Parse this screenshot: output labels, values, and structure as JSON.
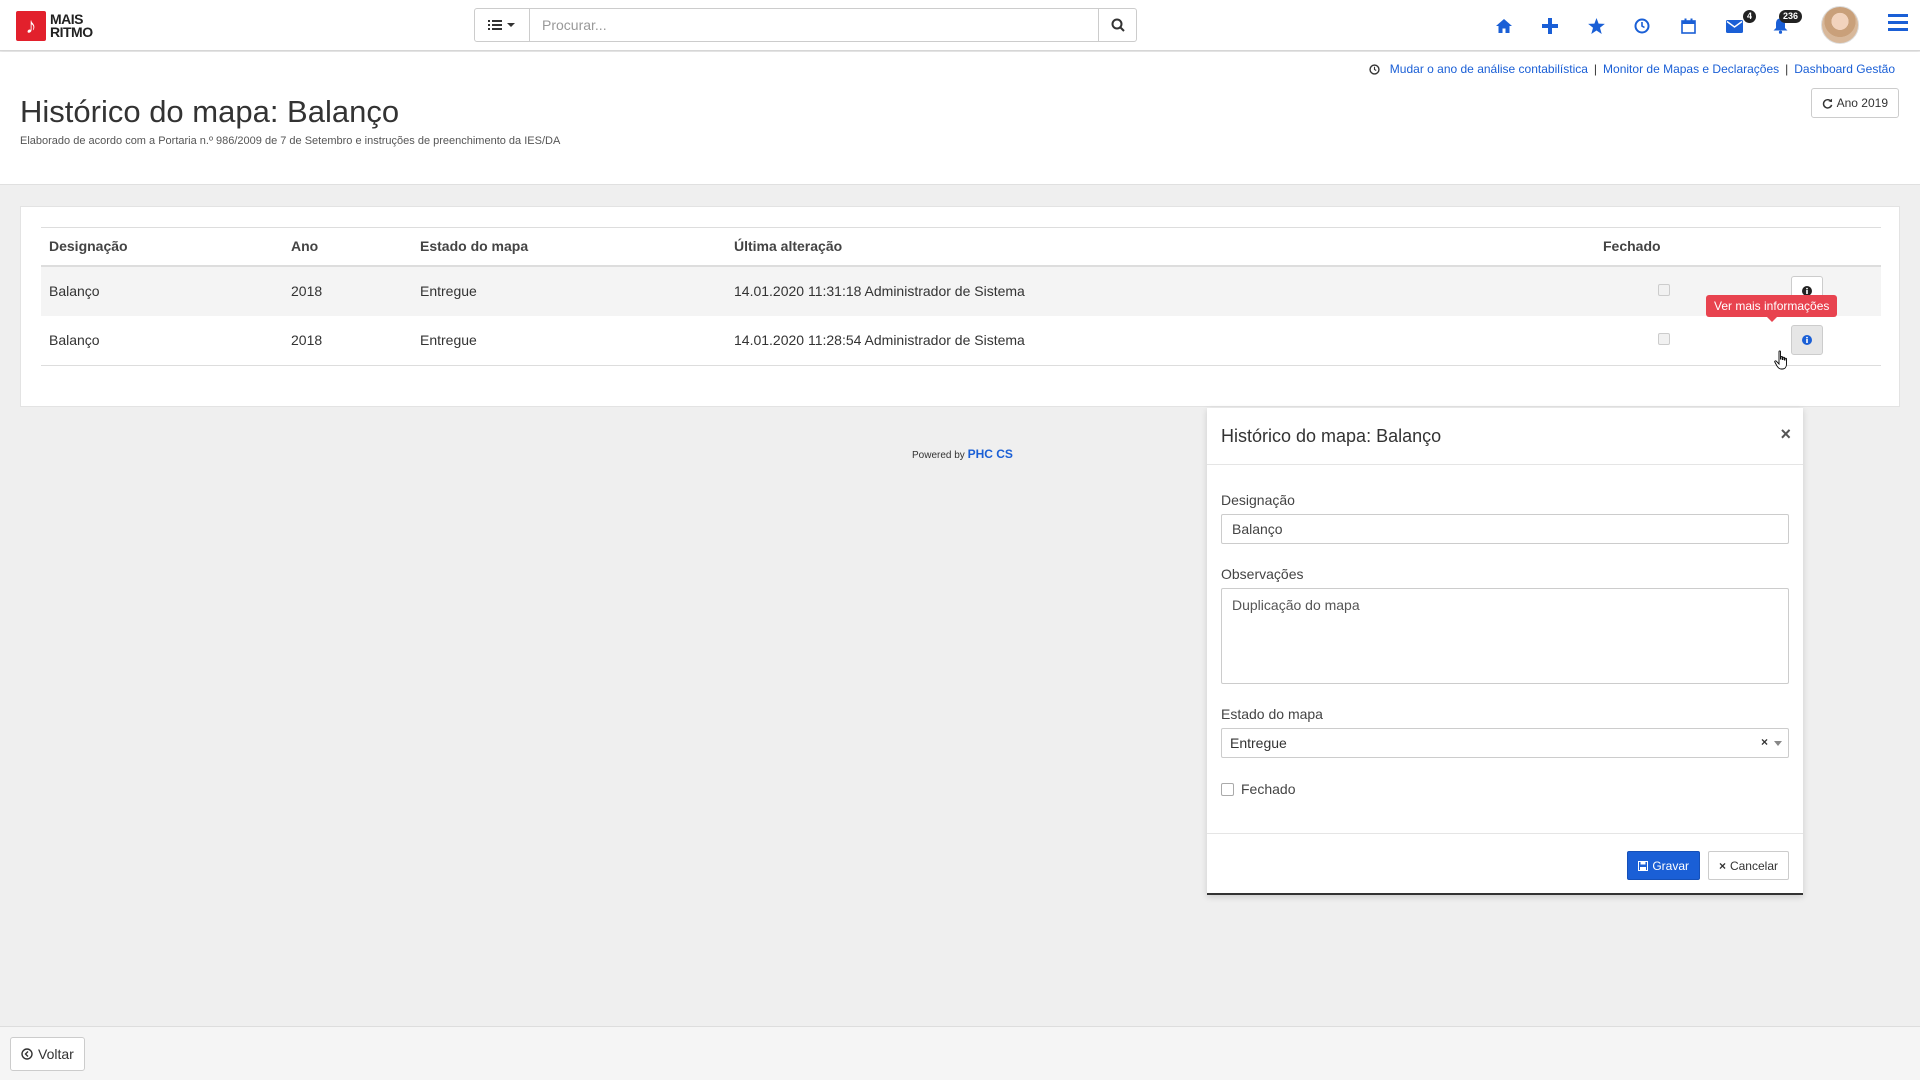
{
  "brand": {
    "line1": "MAIS",
    "line2": "RITMO",
    "color": "#e2202c"
  },
  "search": {
    "placeholder": "Procurar..."
  },
  "nav": {
    "icons": [
      "home-icon",
      "plus-icon",
      "star-icon",
      "clock-icon",
      "calendar-icon",
      "envelope-icon",
      "bell-icon"
    ],
    "mail_badge": "4",
    "notif_badge": "236",
    "accent": "#1a5fd6"
  },
  "header": {
    "links": [
      "Mudar o ano de análise contabilística",
      "Monitor de Mapas e Declarações",
      "Dashboard Gestão"
    ],
    "year_button": "Ano 2019",
    "title": "Histórico do mapa: Balanço",
    "subtitle": "Elaborado de acordo com a Portaria n.º 986/2009 de 7 de Setembro e instruções de preenchimento da IES/DA"
  },
  "table": {
    "columns": [
      "Designação",
      "Ano",
      "Estado do mapa",
      "Última alteração",
      "Fechado"
    ],
    "rows": [
      {
        "designacao": "Balanço",
        "ano": "2018",
        "estado": "Entregue",
        "alteracao": "14.01.2020 11:31:18 Administrador de Sistema",
        "fechado": false
      },
      {
        "designacao": "Balanço",
        "ano": "2018",
        "estado": "Entregue",
        "alteracao": "14.01.2020 11:28:54 Administrador de Sistema",
        "fechado": false
      }
    ],
    "tooltip": "Ver mais informações"
  },
  "footer": {
    "powered_by": "Powered by",
    "product": "PHC CS"
  },
  "modal": {
    "title": "Histórico do mapa: Balanço",
    "designacao_label": "Designação",
    "designacao_value": "Balanço",
    "observacoes_label": "Observações",
    "observacoes_value": "Duplicação do mapa",
    "estado_label": "Estado do mapa",
    "estado_value": "Entregue",
    "fechado_label": "Fechado",
    "save_label": "Gravar",
    "cancel_label": "Cancelar"
  },
  "bottom": {
    "back_label": "Voltar"
  }
}
